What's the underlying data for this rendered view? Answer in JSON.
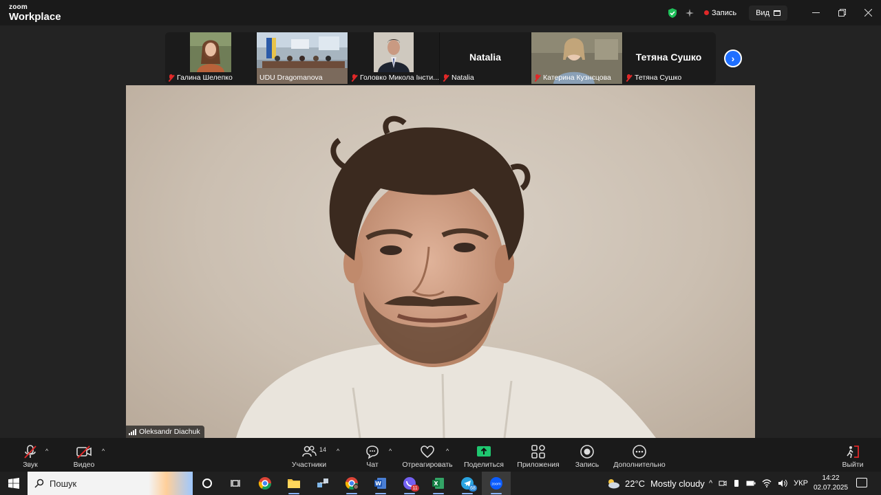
{
  "app": {
    "logo_small": "zoom",
    "logo_big": "Workplace"
  },
  "titlebar": {
    "recording_label": "Запись",
    "view_label": "Вид"
  },
  "participants_strip": [
    {
      "name": "Галина Шелепко",
      "muted": true,
      "has_video": true
    },
    {
      "name": "UDU Dragomanova",
      "muted": false,
      "has_video": true
    },
    {
      "name": "Головко Микола Інсти...",
      "muted": true,
      "has_video": true
    },
    {
      "name": "Natalia",
      "muted": true,
      "has_video": false,
      "display_name": "Natalia"
    },
    {
      "name": "Катерина Кузнєцова",
      "muted": true,
      "has_video": true
    },
    {
      "name": "Тетяна Сушко",
      "muted": true,
      "has_video": false,
      "display_name": "Тетяна Сушко"
    }
  ],
  "main_speaker": {
    "name": "Oleksandr Diachuk"
  },
  "toolbar": {
    "audio": "Звук",
    "video": "Видео",
    "participants": "Участники",
    "participants_count": "14",
    "chat": "Чат",
    "react": "Отреагировать",
    "share": "Поделиться",
    "apps": "Приложения",
    "record": "Запись",
    "more": "Дополнительно",
    "leave": "Выйти"
  },
  "taskbar": {
    "search_placeholder": "Пошук",
    "viber_badge": "11",
    "telegram_badge": "68",
    "weather_temp": "22°C",
    "weather_desc": "Mostly cloudy",
    "language": "УКР",
    "time": "14:22",
    "date": "02.07.2025"
  },
  "colors": {
    "accent": "#1f6fff",
    "mute_red": "#e02828",
    "share_green": "#1fc770"
  }
}
